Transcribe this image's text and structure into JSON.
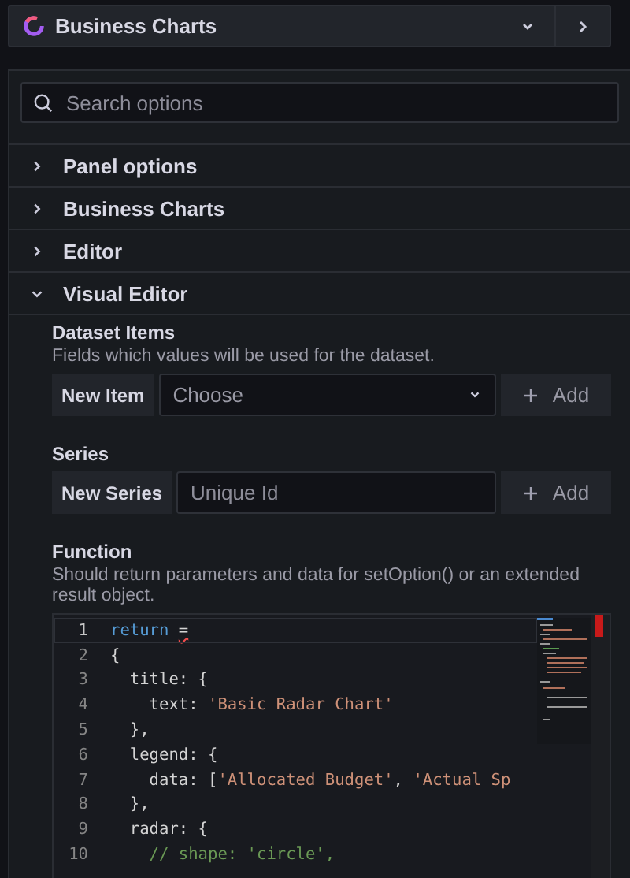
{
  "header": {
    "title": "Business Charts"
  },
  "search": {
    "placeholder": "Search options"
  },
  "sections": [
    {
      "label": "Panel options",
      "expanded": false
    },
    {
      "label": "Business Charts",
      "expanded": false
    },
    {
      "label": "Editor",
      "expanded": false
    },
    {
      "label": "Visual Editor",
      "expanded": true
    }
  ],
  "dataset_items": {
    "label": "Dataset Items",
    "description": "Fields which values will be used for the dataset.",
    "prefix": "New Item",
    "select_placeholder": "Choose",
    "add_button": "Add"
  },
  "series": {
    "label": "Series",
    "prefix": "New Series",
    "input_placeholder": "Unique Id",
    "add_button": "Add"
  },
  "function": {
    "label": "Function",
    "description": "Should return parameters and data for setOption() or an extended result object.",
    "code_lines": [
      {
        "number": "1",
        "tokens": [
          {
            "kind": "keyword",
            "text": "return "
          },
          {
            "kind": "error",
            "text": "="
          }
        ]
      },
      {
        "number": "2",
        "tokens": [
          {
            "kind": "plain",
            "text": "{"
          }
        ]
      },
      {
        "number": "3",
        "tokens": [
          {
            "kind": "plain",
            "text": "  title: {"
          }
        ]
      },
      {
        "number": "4",
        "tokens": [
          {
            "kind": "plain",
            "text": "    text: "
          },
          {
            "kind": "string",
            "text": "'Basic Radar Chart'"
          }
        ]
      },
      {
        "number": "5",
        "tokens": [
          {
            "kind": "plain",
            "text": "  },"
          }
        ]
      },
      {
        "number": "6",
        "tokens": [
          {
            "kind": "plain",
            "text": "  legend: {"
          }
        ]
      },
      {
        "number": "7",
        "tokens": [
          {
            "kind": "plain",
            "text": "    data: ["
          },
          {
            "kind": "string",
            "text": "'Allocated Budget'"
          },
          {
            "kind": "plain",
            "text": ", "
          },
          {
            "kind": "string",
            "text": "'Actual Sp"
          }
        ]
      },
      {
        "number": "8",
        "tokens": [
          {
            "kind": "plain",
            "text": "  },"
          }
        ]
      },
      {
        "number": "9",
        "tokens": [
          {
            "kind": "plain",
            "text": "  radar: {"
          }
        ]
      },
      {
        "number": "10",
        "tokens": [
          {
            "kind": "comment",
            "text": "    // shape: 'circle',"
          }
        ]
      }
    ]
  }
}
